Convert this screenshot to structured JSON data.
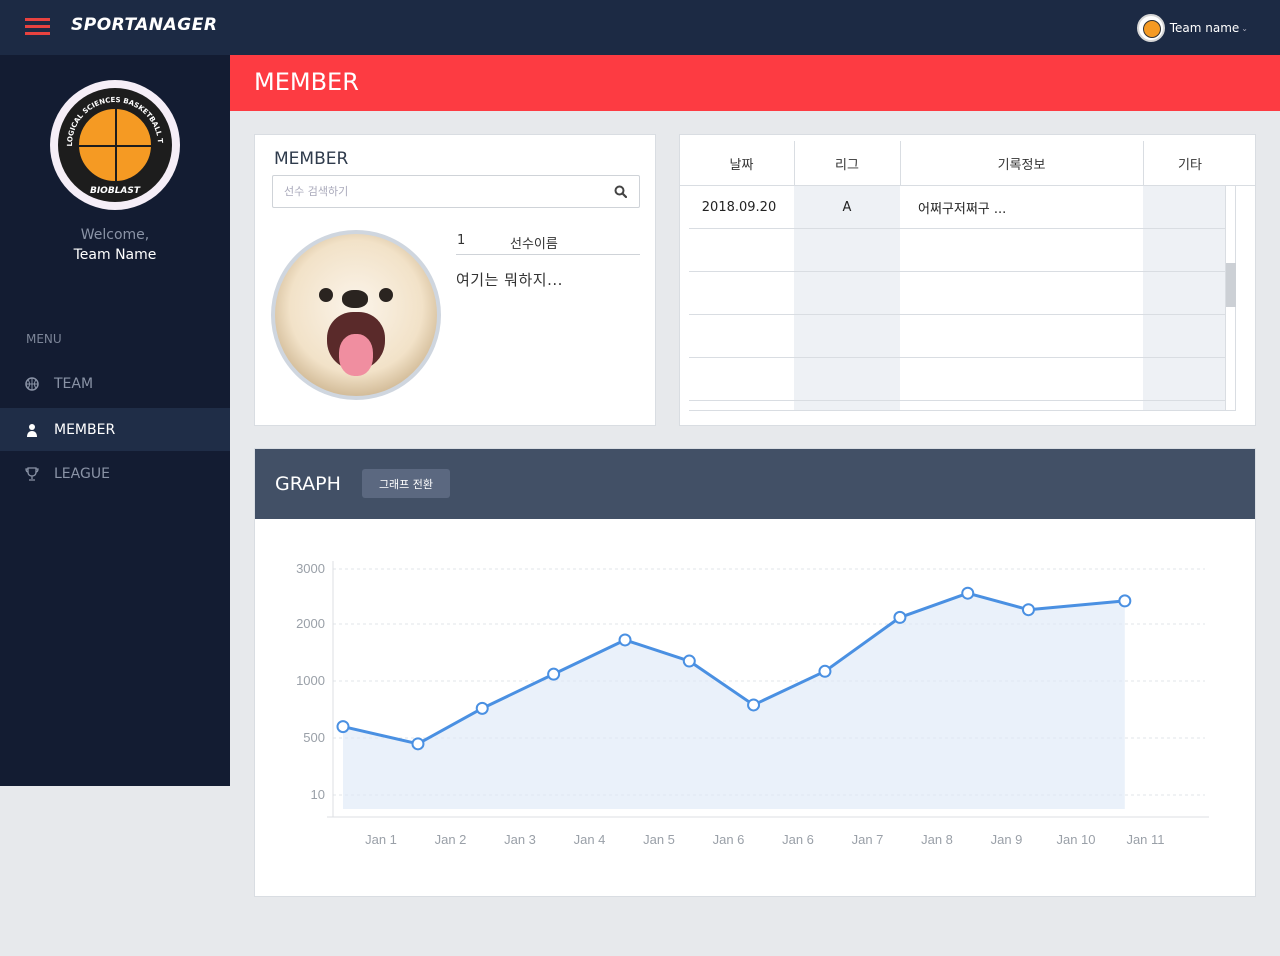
{
  "topbar": {
    "logo": "SPORTANAGER",
    "team_name": "Team name",
    "caret": "⌄"
  },
  "sidebar": {
    "welcome": "Welcome,",
    "welcome_name": "Team Name",
    "menu_title": "MENU",
    "items": [
      {
        "label": "TEAM",
        "icon": "ball-icon",
        "active": false
      },
      {
        "label": "MEMBER",
        "icon": "user-icon",
        "active": true
      },
      {
        "label": "LEAGUE",
        "icon": "trophy-icon",
        "active": false
      }
    ],
    "logo_text": [
      "BIOLOGICAL SCIENCES BASKETBALL TEAM",
      "BIOBLAST"
    ]
  },
  "page": {
    "title": "MEMBER"
  },
  "member_card": {
    "title": "MEMBER",
    "search_placeholder": "선수 검색하기",
    "player_number": "1",
    "player_name": "선수이름",
    "player_desc": "여기는 뭐하지..."
  },
  "records": {
    "headers": [
      "날짜",
      "리그",
      "기록정보",
      "기타"
    ],
    "rows": [
      [
        "2018.09.20",
        "A",
        "어쩌구저쩌구 ...",
        ""
      ],
      [
        "",
        "",
        "",
        ""
      ],
      [
        "",
        "",
        "",
        ""
      ],
      [
        "",
        "",
        "",
        ""
      ],
      [
        "",
        "",
        "",
        ""
      ]
    ]
  },
  "graph": {
    "title": "GRAPH",
    "toggle_label": "그래프 전환"
  },
  "colors": {
    "topbar": "#1c2a44",
    "sidebar": "#131c32",
    "accent_red": "#fd3b42",
    "graph_header": "#425066",
    "line": "#4a90e2"
  },
  "chart_data": {
    "type": "area",
    "x_labels": [
      "Jan 1",
      "Jan 2",
      "Jan 3",
      "Jan 4",
      "Jan 5",
      "Jan 6",
      "Jan 6",
      "Jan 7",
      "Jan 8",
      "Jan 9",
      "Jan 10",
      "Jan 11"
    ],
    "y_ticks": [
      "3000",
      "2000",
      "1000",
      "500",
      "10"
    ],
    "y_tick_levels": [
      3000,
      2000,
      1000,
      500,
      10
    ],
    "points": [
      {
        "x": 0.0,
        "y": 600
      },
      {
        "x": 1.05,
        "y": 450
      },
      {
        "x": 1.95,
        "y": 760
      },
      {
        "x": 2.95,
        "y": 1120
      },
      {
        "x": 3.95,
        "y": 1720
      },
      {
        "x": 4.85,
        "y": 1350
      },
      {
        "x": 5.75,
        "y": 790
      },
      {
        "x": 6.75,
        "y": 1170
      },
      {
        "x": 7.8,
        "y": 2120
      },
      {
        "x": 8.75,
        "y": 2560
      },
      {
        "x": 9.6,
        "y": 2260
      },
      {
        "x": 10.95,
        "y": 2420
      }
    ],
    "grid": true
  }
}
